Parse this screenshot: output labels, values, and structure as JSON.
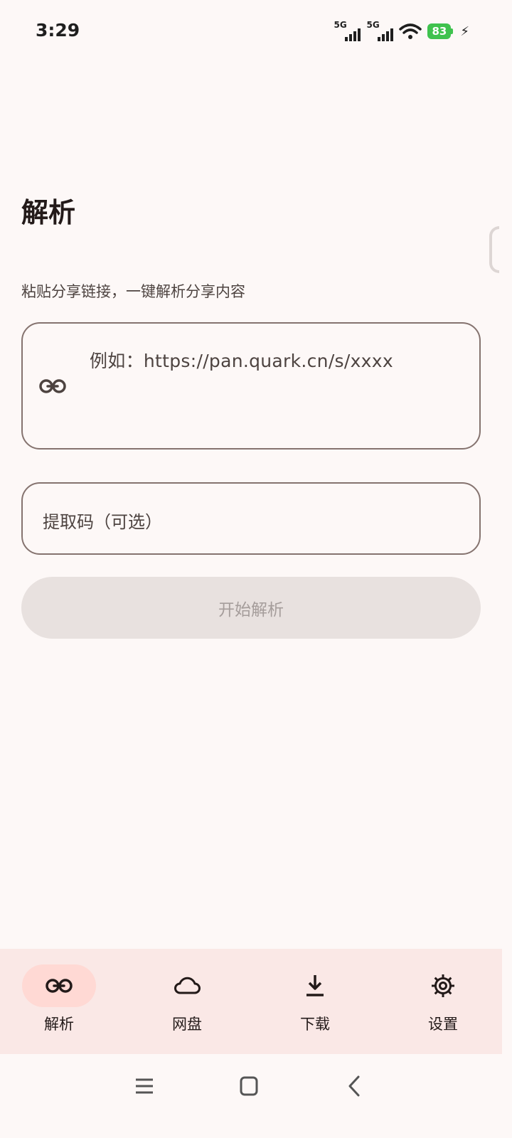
{
  "status_bar": {
    "time": "3:29",
    "network_1": "5G",
    "network_2": "5G",
    "battery": "83",
    "icons": [
      "signal-icon",
      "signal-icon",
      "wifi-icon",
      "battery-icon",
      "charging-bolt-icon"
    ],
    "battery_color": "#3fc24e"
  },
  "page": {
    "title": "解析",
    "subtitle": "粘贴分享链接，一键解析分享内容"
  },
  "link_input": {
    "placeholder": "例如：https://pan.quark.cn/s/xxxx",
    "icon": "link-icon"
  },
  "code_input": {
    "placeholder": "提取码（可选）"
  },
  "start_button": {
    "label": "开始解析",
    "enabled": false
  },
  "bottom_nav": {
    "items": [
      {
        "label": "解析",
        "icon": "link-icon",
        "active": true
      },
      {
        "label": "网盘",
        "icon": "cloud-icon",
        "active": false
      },
      {
        "label": "下载",
        "icon": "download-icon",
        "active": false
      },
      {
        "label": "设置",
        "icon": "gear-icon",
        "active": false
      }
    ]
  },
  "system_nav": {
    "buttons": [
      "menu-icon",
      "home-icon",
      "back-icon"
    ]
  },
  "colors": {
    "background": "#fdf8f7",
    "nav_background": "#fae8e6",
    "active_indicator": "#ffd9d4",
    "outline": "#85736f",
    "disabled_button": "#e8e1df"
  }
}
